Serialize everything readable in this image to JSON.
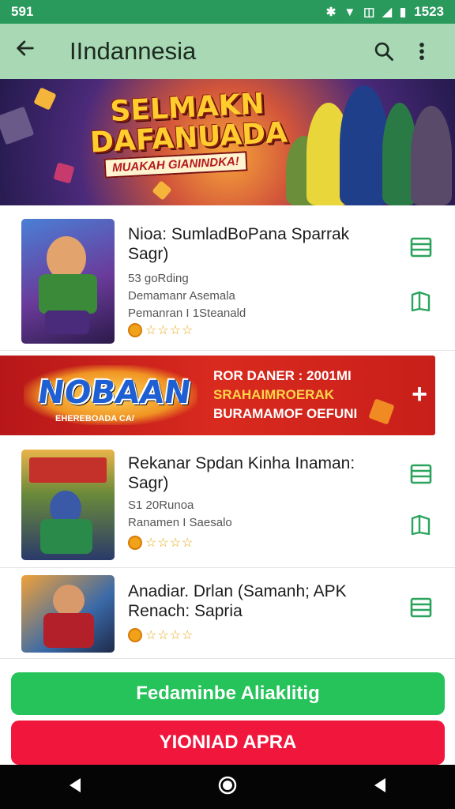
{
  "status_bar": {
    "time": "591",
    "clock": "1523"
  },
  "app_bar": {
    "title": "IIndannesia"
  },
  "top_banner": {
    "headline_1": "SELMAKN",
    "headline_2": "DAFANUADA",
    "subline": "MUAKAH GIANINDKA!"
  },
  "apps": [
    {
      "name": "Nioa: SumladBoPana Sparrak Sagr)",
      "meta": [
        "53 goRding",
        "Demamanr Asemala",
        "Pemanran I 1Steanald"
      ]
    },
    {
      "name": "Rekanar Spdan Kinha Inaman: Sagr)",
      "meta": [
        "S1 20Runoa",
        "Ranamen I Saesalo"
      ]
    },
    {
      "name": "Anadiar. Drlan (Samanh; APK Renach: Sapria",
      "meta": []
    }
  ],
  "promo": {
    "logo": "NOBAAN",
    "logo_sub": "EHEREBOADA CA/",
    "line_1": "ROR DANER : 2001MI",
    "line_2": "SRAHAIMROERAK",
    "line_3": "BURAMAMOF OEFUNI"
  },
  "buttons": {
    "primary": "Fedaminbe Aliaklitig",
    "secondary": "YIONIAD APRA"
  }
}
